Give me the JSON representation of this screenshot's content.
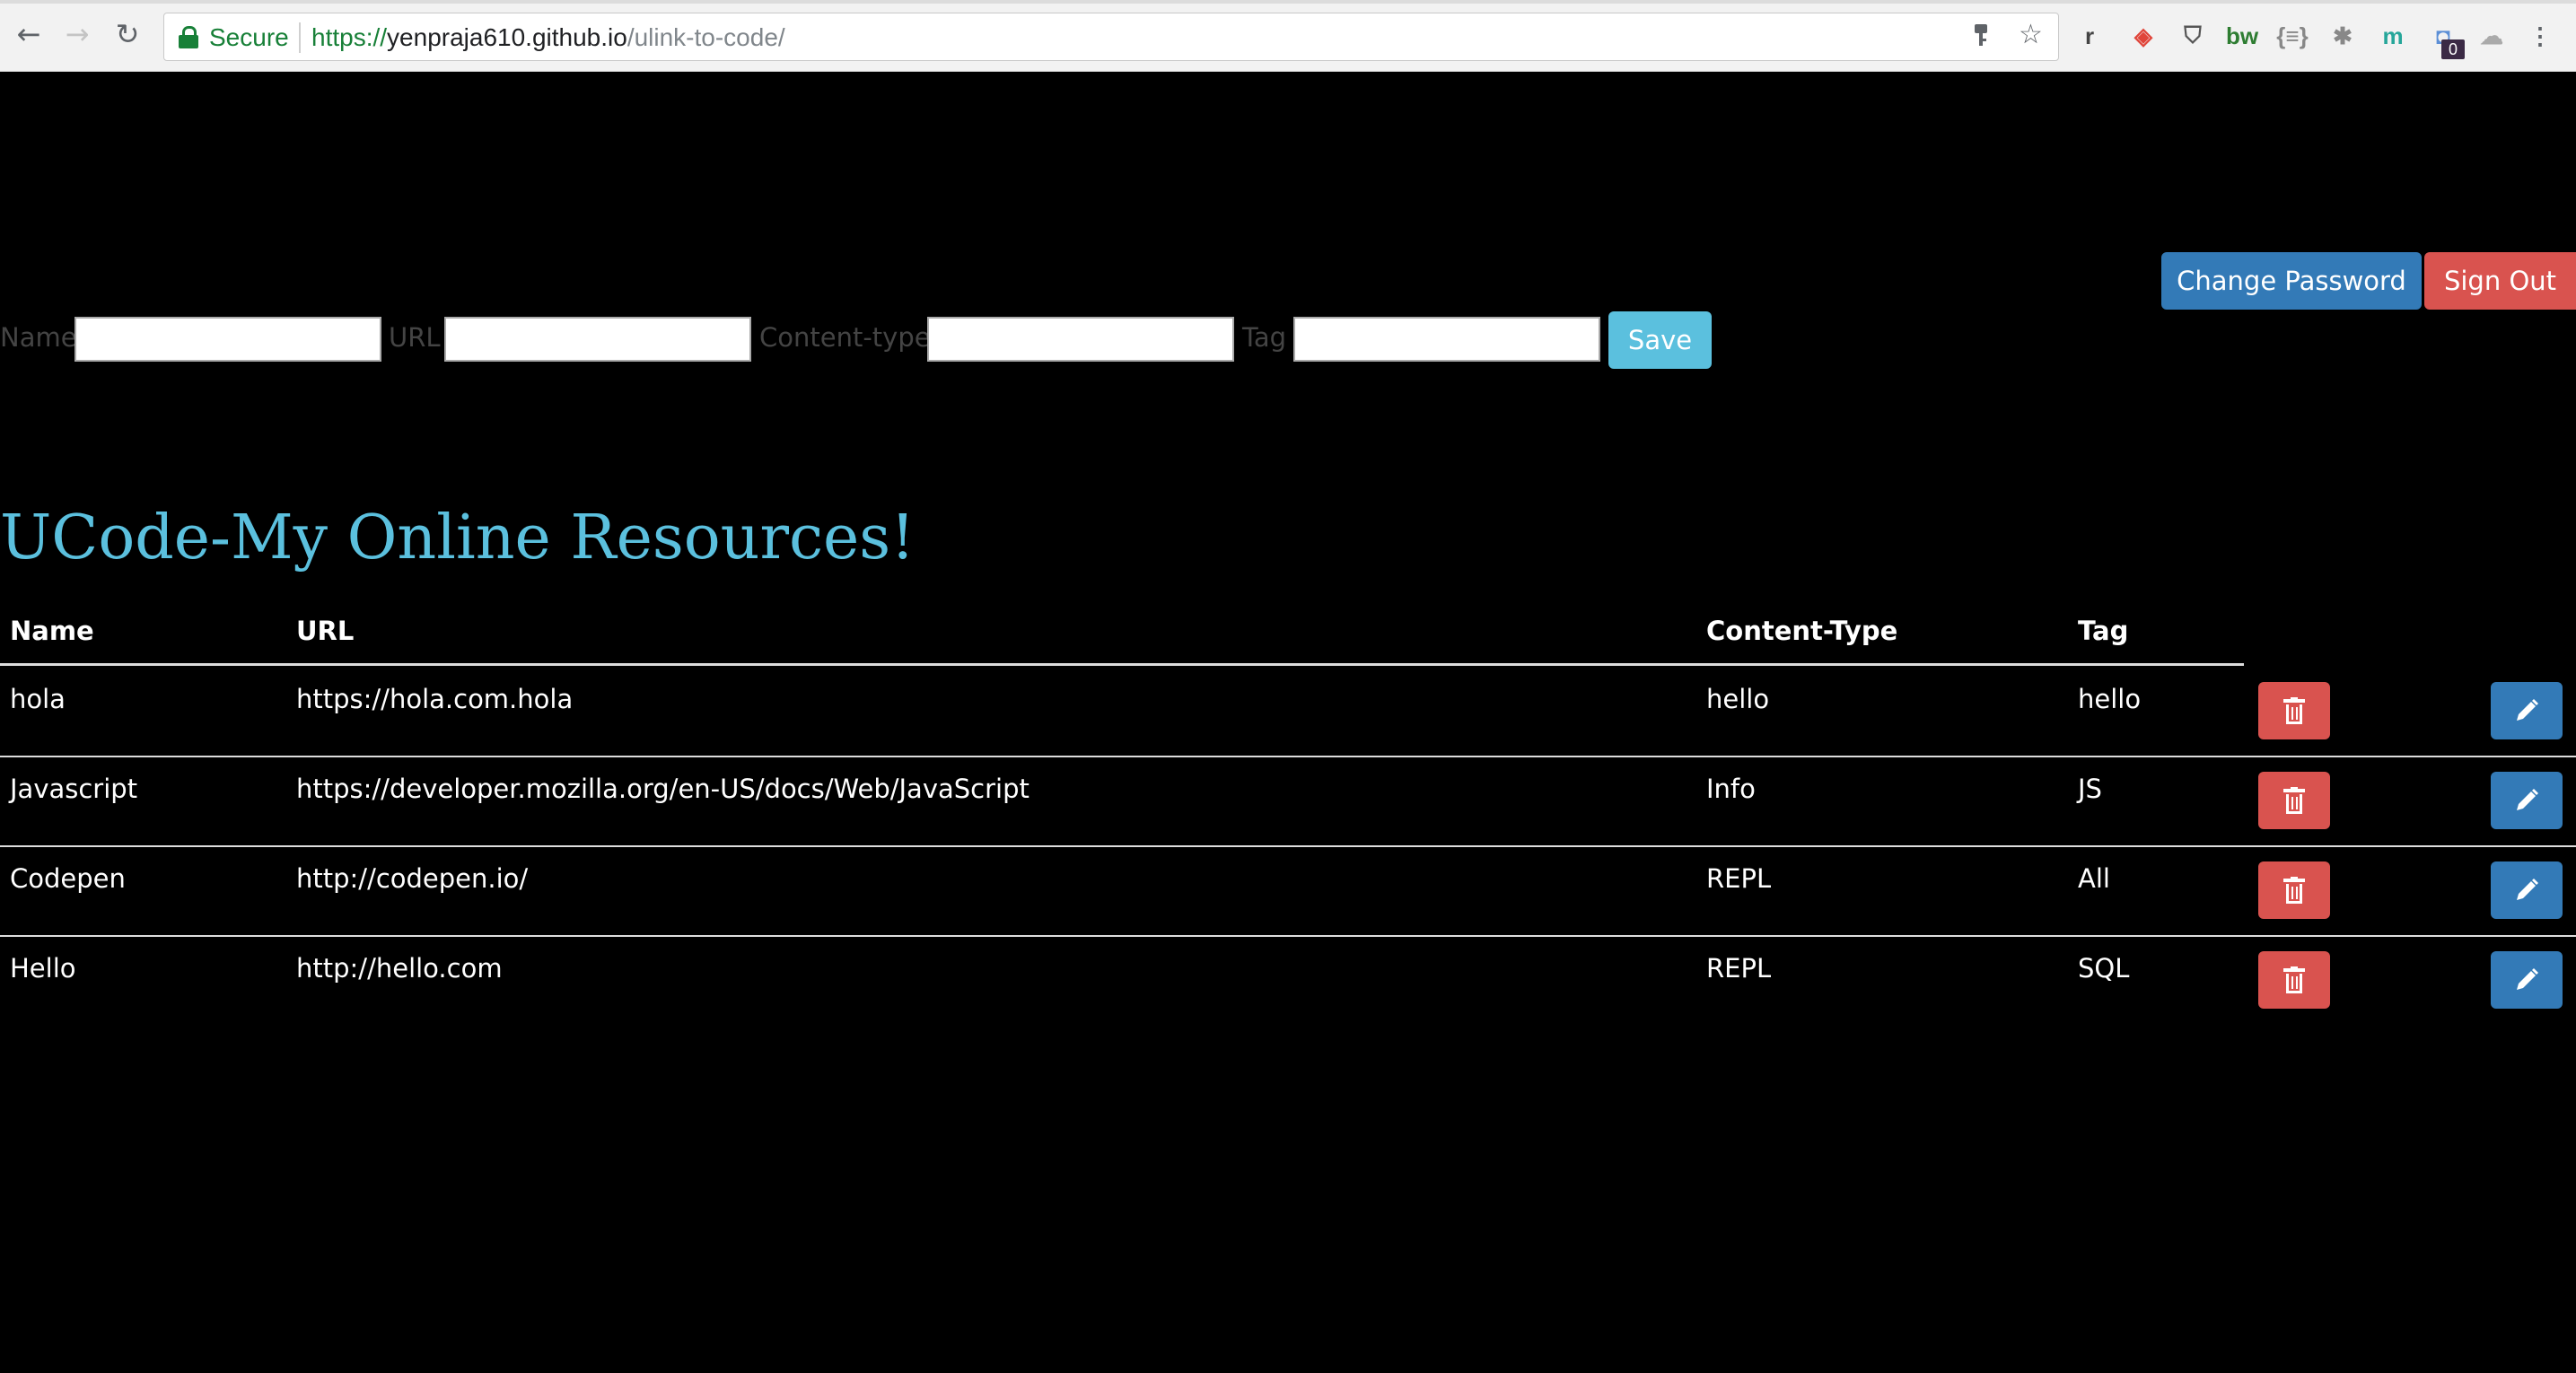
{
  "browser": {
    "nav": {
      "back": "←",
      "forward": "→",
      "reload": "↻"
    },
    "security_label": "Secure",
    "url": {
      "scheme": "https://",
      "host": "yenpraja610.github.io",
      "path": "/ulink-to-code/"
    },
    "omnibox_icons": {
      "key": "key-icon",
      "star": "☆"
    },
    "extensions": [
      {
        "name": "readability-icon",
        "glyph": "r",
        "color": "#444444"
      },
      {
        "name": "shield-icon",
        "glyph": "◈",
        "color": "#e0453a"
      },
      {
        "name": "pocket-icon",
        "glyph": "⛉",
        "color": "#555555"
      },
      {
        "name": "bw-icon",
        "glyph": "bw",
        "color": "#2e7d32"
      },
      {
        "name": "json-icon",
        "glyph": "{≡}",
        "color": "#888888"
      },
      {
        "name": "bug-icon",
        "glyph": "✱",
        "color": "#888888"
      },
      {
        "name": "m-circle-icon",
        "glyph": "m",
        "color": "#26a69a"
      },
      {
        "name": "counter-icon",
        "glyph": "◘",
        "color": "#5c8fd6"
      },
      {
        "name": "ghost-icon",
        "glyph": "☁",
        "color": "#aaaaaa"
      },
      {
        "name": "menu-icon",
        "glyph": "⋮",
        "color": "#5f6368"
      }
    ],
    "badge_count": "0"
  },
  "header": {
    "change_password": "Change Password",
    "sign_out": "Sign Out"
  },
  "form": {
    "name_label": "Name",
    "url_label": "URL",
    "content_type_label": "Content-type",
    "tag_label": "Tag",
    "name_value": "",
    "url_value": "",
    "content_type_value": "",
    "tag_value": "",
    "save": "Save"
  },
  "title": "UCode-My Online Resources!",
  "table": {
    "headers": {
      "name": "Name",
      "url": "URL",
      "content_type": "Content-Type",
      "tag": "Tag"
    },
    "rows": [
      {
        "name": "hola",
        "url": "https://hola.com.hola",
        "content_type": "hello",
        "tag": "hello"
      },
      {
        "name": "Javascript",
        "url": "https://developer.mozilla.org/en-US/docs/Web/JavaScript",
        "content_type": "Info",
        "tag": "JS"
      },
      {
        "name": "Codepen",
        "url": "http://codepen.io/",
        "content_type": "REPL",
        "tag": "All"
      },
      {
        "name": "Hello",
        "url": "http://hello.com",
        "content_type": "REPL",
        "tag": "SQL"
      }
    ]
  },
  "colors": {
    "primary": "#337ab7",
    "danger": "#d9534f",
    "info": "#5bc0de",
    "background": "#000000"
  }
}
